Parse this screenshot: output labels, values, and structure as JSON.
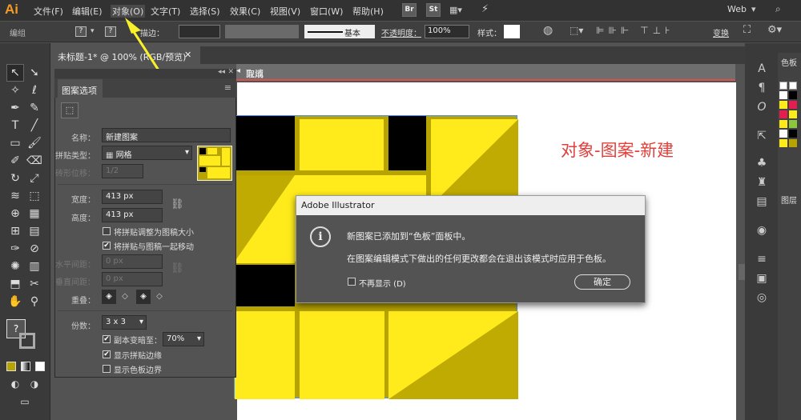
{
  "menubar": {
    "app_logo": "Ai",
    "items": [
      "文件(F)",
      "编辑(E)",
      "对象(O)",
      "文字(T)",
      "选择(S)",
      "效果(C)",
      "视图(V)",
      "窗口(W)",
      "帮助(H)"
    ],
    "br": "Br",
    "st": "St",
    "workspace": "Web",
    "search_icon": "search-icon"
  },
  "control": {
    "edit_group": "编组",
    "stroke_label": "描边：",
    "stroke_style": "基本",
    "opacity_label": "不透明度：",
    "opacity_value": "100%",
    "style_label": "样式：",
    "transform": "变换"
  },
  "document": {
    "tab_title": "未标题-1* @ 100% (RGB/预览)",
    "done": "完成",
    "cancel": "取消"
  },
  "annotation": "对象-图案-新建",
  "pattern_panel": {
    "title": "图案选项",
    "name_label": "名称：",
    "name_value": "新建图案",
    "tile_type_label": "拼贴类型：",
    "tile_type_value": "网格",
    "brick_offset_label": "砖形位移：",
    "brick_offset_value": "1/2",
    "width_label": "宽度：",
    "width_value": "413 px",
    "height_label": "高度：",
    "height_value": "413 px",
    "resize_tile": "将拼贴调整为图稿大小",
    "move_tile": "将拼贴与图稿一起移动",
    "h_spacing_label": "水平间距：",
    "h_spacing_value": "0 px",
    "v_spacing_label": "垂直间距：",
    "v_spacing_value": "0 px",
    "overlap_label": "重叠：",
    "copies_label": "份数：",
    "copies_value": "3 x 3",
    "dim_copies_label": "副本变暗至：",
    "dim_copies_value": "70%",
    "show_tile_edge": "显示拼贴边缘",
    "show_swatch_bounds": "显示色板边界",
    "checks": {
      "resize_tile": false,
      "move_tile": true,
      "dim_copies": true,
      "show_tile_edge": true,
      "show_swatch_bounds": false
    }
  },
  "dialog": {
    "title": "Adobe Illustrator",
    "message1": "新图案已添加到“色板”面板中。",
    "message2": "在图案编辑模式下做出的任何更改都会在退出该模式时应用于色板。",
    "dont_show": "不再显示 (D)",
    "ok": "确定"
  },
  "right_panel": {
    "swatches_tab": "色板",
    "layers_tab": "图层"
  },
  "colors": {
    "pattern_yellow": "#ffeb1c",
    "pattern_olive": "#b8a400",
    "annotation_red": "#e0403c",
    "arrow_yellow": "#f7f02a"
  }
}
